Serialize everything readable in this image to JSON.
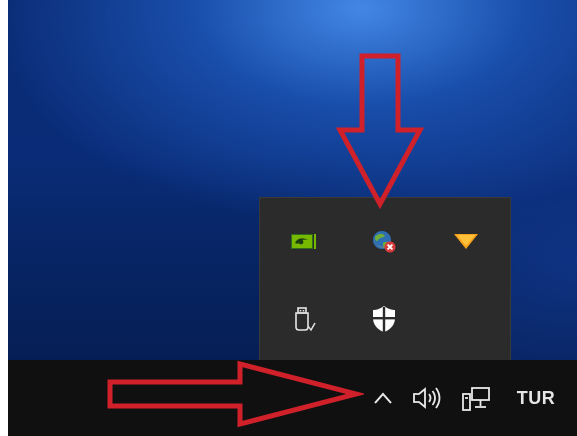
{
  "desktop": {
    "wallpaper": "windows-10-blue",
    "colors": {
      "wallpaper_light": "#4a8ce8",
      "wallpaper_dark": "#041a4c",
      "taskbar": "#101010",
      "flyout": "#2b2b2b",
      "annotation_arrow": "#d0202a"
    }
  },
  "tray_flyout": {
    "icons": [
      {
        "name": "nvidia-icon",
        "row": 1,
        "col": 1
      },
      {
        "name": "network-warning-globe-icon",
        "row": 1,
        "col": 2
      },
      {
        "name": "orange-triangle-app-icon",
        "row": 1,
        "col": 3
      },
      {
        "name": "usb-safely-remove-icon",
        "row": 2,
        "col": 1
      },
      {
        "name": "windows-defender-shield-icon",
        "row": 2,
        "col": 2
      }
    ]
  },
  "taskbar": {
    "items": [
      {
        "name": "show-hidden-icons-chevron-up-icon"
      },
      {
        "name": "volume-speaker-icon"
      },
      {
        "name": "network-wired-icon"
      }
    ],
    "language_label": "TUR"
  },
  "annotations": [
    {
      "name": "red-arrow-down",
      "direction": "down",
      "points_to": "network-warning-globe-icon"
    },
    {
      "name": "red-arrow-right",
      "direction": "right",
      "points_to": "show-hidden-icons-chevron-up-icon"
    }
  ]
}
